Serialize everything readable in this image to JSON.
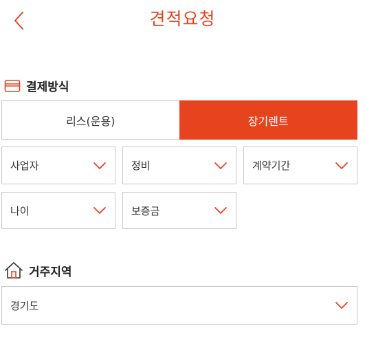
{
  "header": {
    "title": "견적요청",
    "back_icon": "chevron-left-icon"
  },
  "colors": {
    "accent": "#e8431f",
    "border": "#c8c8c8",
    "text": "#333333"
  },
  "payment": {
    "section_title": "결제방식",
    "icon": "credit-card-icon",
    "options": [
      {
        "label": "리스(운용)",
        "selected": false
      },
      {
        "label": "장기렌트",
        "selected": true
      }
    ]
  },
  "filters": {
    "business": {
      "label": "사업자"
    },
    "maintenance": {
      "label": "정비"
    },
    "contract_period": {
      "label": "계약기간"
    },
    "age": {
      "label": "나이"
    },
    "deposit": {
      "label": "보증금"
    }
  },
  "residence": {
    "section_title": "거주지역",
    "icon": "house-icon",
    "value": "경기도"
  }
}
